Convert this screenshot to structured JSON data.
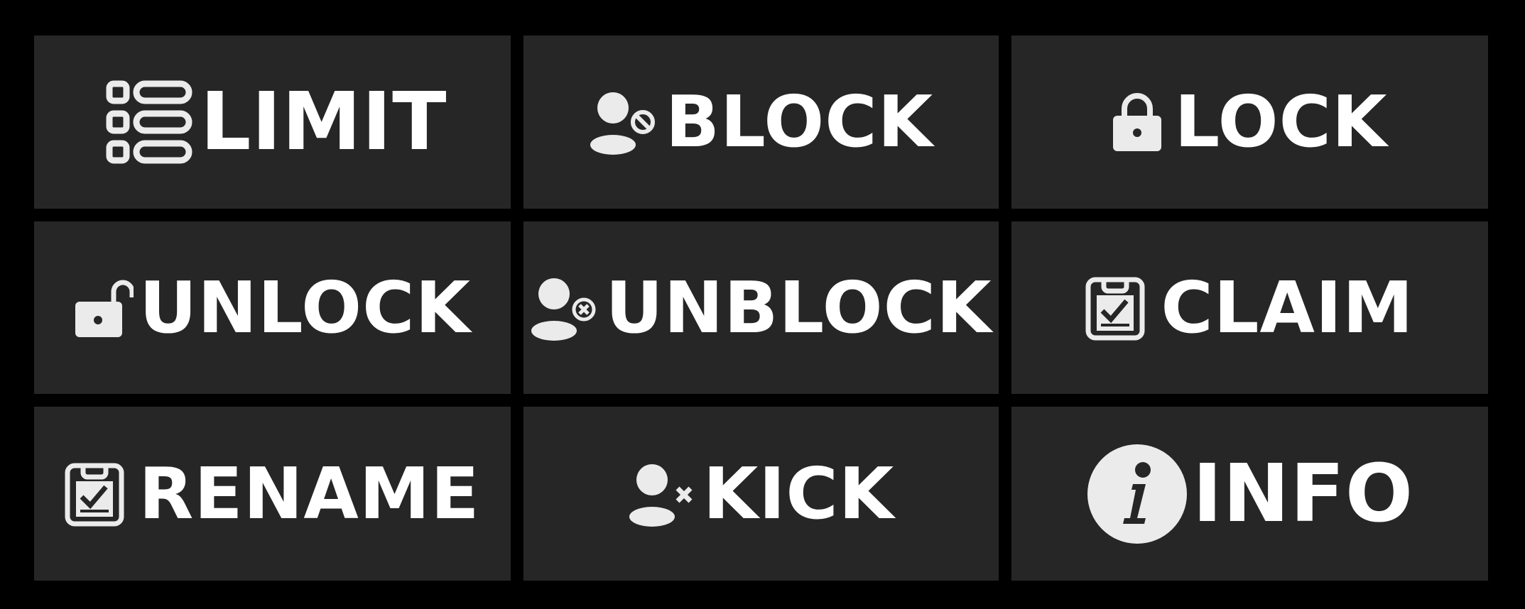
{
  "colors": {
    "background": "#000000",
    "tile": "#262626",
    "text": "#ffffff",
    "icon": "#ebebeb"
  },
  "buttons": [
    {
      "label": "LIMIT",
      "icon": "list-limit-icon"
    },
    {
      "label": "BLOCK",
      "icon": "user-block-icon"
    },
    {
      "label": "LOCK",
      "icon": "lock-icon"
    },
    {
      "label": "UNLOCK",
      "icon": "unlock-icon"
    },
    {
      "label": "UNBLOCK",
      "icon": "user-unblock-icon"
    },
    {
      "label": "CLAIM",
      "icon": "clipboard-check-icon"
    },
    {
      "label": "RENAME",
      "icon": "clipboard-check-icon"
    },
    {
      "label": "KICK",
      "icon": "user-kick-icon"
    },
    {
      "label": "INFO",
      "icon": "info-icon"
    }
  ]
}
